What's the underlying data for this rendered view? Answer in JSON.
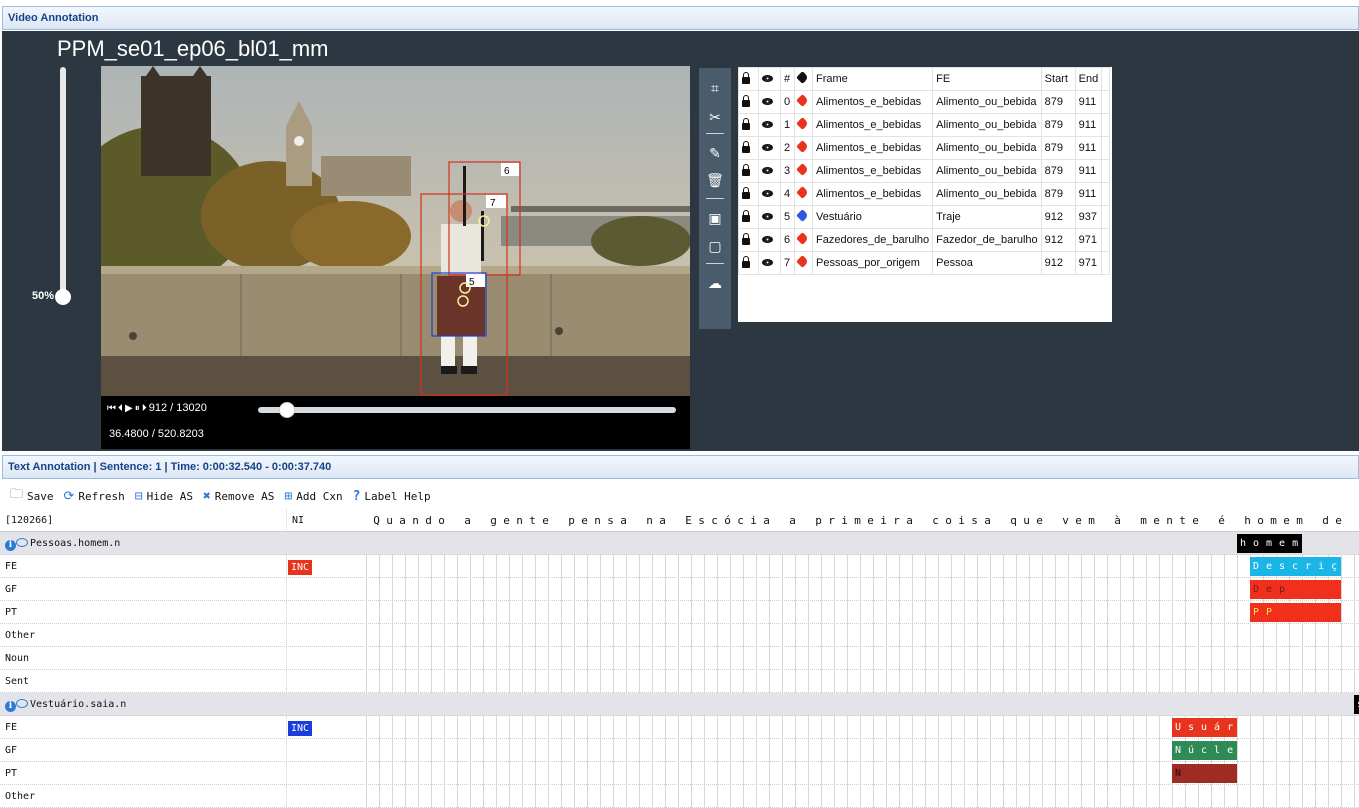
{
  "video_panel": {
    "header": "Video Annotation",
    "title": "PPM_se01_ep06_bl01_mm",
    "volume": "50%",
    "frame_counter": "912 / 13020",
    "timecode": "36.4800 / 520.8203",
    "seek_fraction": 0.07,
    "boxes": [
      {
        "label": "6",
        "color": "#d7301f"
      },
      {
        "label": "7",
        "color": "#d7301f"
      },
      {
        "label": "5",
        "color": "#1f3fd0"
      }
    ]
  },
  "objects_table": {
    "columns": [
      "#",
      "Frame",
      "FE",
      "Start",
      "End"
    ],
    "rows": [
      {
        "id": "0",
        "tag_color": "#e8341c",
        "frame": "Alimentos_e_bebidas",
        "fe": "Alimento_ou_bebida",
        "start": "879",
        "end": "911"
      },
      {
        "id": "1",
        "tag_color": "#e8341c",
        "frame": "Alimentos_e_bebidas",
        "fe": "Alimento_ou_bebida",
        "start": "879",
        "end": "911"
      },
      {
        "id": "2",
        "tag_color": "#e8341c",
        "frame": "Alimentos_e_bebidas",
        "fe": "Alimento_ou_bebida",
        "start": "879",
        "end": "911"
      },
      {
        "id": "3",
        "tag_color": "#e8341c",
        "frame": "Alimentos_e_bebidas",
        "fe": "Alimento_ou_bebida",
        "start": "879",
        "end": "911"
      },
      {
        "id": "4",
        "tag_color": "#e8341c",
        "frame": "Alimentos_e_bebidas",
        "fe": "Alimento_ou_bebida",
        "start": "879",
        "end": "911"
      },
      {
        "id": "5",
        "tag_color": "#2a5ae0",
        "frame": "Vestuário",
        "fe": "Traje",
        "start": "912",
        "end": "937"
      },
      {
        "id": "6",
        "tag_color": "#e8341c",
        "frame": "Fazedores_de_barulho",
        "fe": "Fazedor_de_barulho",
        "start": "912",
        "end": "971"
      },
      {
        "id": "7",
        "tag_color": "#e8341c",
        "frame": "Pessoas_por_origem",
        "fe": "Pessoa",
        "start": "912",
        "end": "971"
      }
    ]
  },
  "text_panel": {
    "header": "Text Annotation | Sentence: 1 | Time: 0:00:32.540 - 0:00:37.740",
    "toolbar": {
      "save": "Save",
      "refresh": "Refresh",
      "hide_as": "Hide AS",
      "remove_as": "Remove AS",
      "add_cxn": "Add Cxn",
      "label_help": "Label Help"
    },
    "sentence_id": "[120266]",
    "ni_header": "NI",
    "sentence_chars": "Quando a gente pensa na Escócia a primeira coisa que vem à mente é homem de saia,",
    "annotation_sets": [
      {
        "lu": "Pessoas.homem.n",
        "target": "homem",
        "layers": [
          {
            "name": "FE",
            "ni": "INC",
            "ni_color": "#e8341c",
            "spans": [
              {
                "text": "Descriç",
                "bg": "#1ab6e8",
                "fg": "#fff"
              }
            ]
          },
          {
            "name": "GF",
            "spans": [
              {
                "text": "Dep",
                "bg": "#f0301c",
                "fg": "#7a1a10"
              }
            ]
          },
          {
            "name": "PT",
            "spans": [
              {
                "text": "PP",
                "bg": "#f0301c",
                "fg": "#ffe14a"
              }
            ]
          },
          {
            "name": "Other",
            "spans": []
          },
          {
            "name": "Noun",
            "spans": []
          },
          {
            "name": "Sent",
            "spans": []
          }
        ]
      },
      {
        "lu": "Vestuário.saia.n",
        "target": "saia",
        "layers": [
          {
            "name": "FE",
            "ni": "INC",
            "ni_color": "#1a3ddc",
            "spans": [
              {
                "text": "Usuár",
                "bg": "#e8341c",
                "fg": "#fff"
              }
            ]
          },
          {
            "name": "GF",
            "spans": [
              {
                "text": "Núcle",
                "bg": "#2e8a56",
                "fg": "#fff"
              }
            ]
          },
          {
            "name": "PT",
            "spans": [
              {
                "text": "N",
                "bg": "#9e2b24",
                "fg": "#2a0a08"
              }
            ]
          },
          {
            "name": "Other",
            "spans": []
          }
        ]
      }
    ]
  }
}
